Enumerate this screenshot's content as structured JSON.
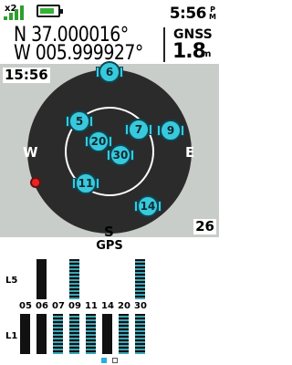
{
  "status": {
    "multiplier": "x2",
    "time": "5:56",
    "ampm": "P\nM",
    "battery_level": 0.85,
    "signal_bars": 4
  },
  "coords": {
    "latitude": "N 37.000016°",
    "longitude": "W 005.999927°",
    "system_label": "GNSS",
    "accuracy": "1.8",
    "accuracy_unit": "m"
  },
  "sky": {
    "time_overlay": "15:56",
    "elevation_overlay": "26",
    "compass": {
      "west": "W",
      "east": "E",
      "south": "S"
    },
    "satellites": [
      "6",
      "5",
      "7",
      "9",
      "20",
      "30",
      "11",
      "14"
    ]
  },
  "bars": {
    "title": "GPS",
    "band_l5": "L5",
    "band_l1": "L1",
    "ids": [
      "05",
      "06",
      "07",
      "09",
      "11",
      "14",
      "20",
      "30"
    ],
    "l5_levels": [
      0,
      0.95,
      0,
      0.95,
      0,
      0,
      0,
      0.95
    ],
    "l1_levels": [
      0.95,
      0.95,
      0.95,
      0.95,
      0.95,
      0.95,
      0.95,
      0.95
    ],
    "accent": "#3aa7b8"
  }
}
